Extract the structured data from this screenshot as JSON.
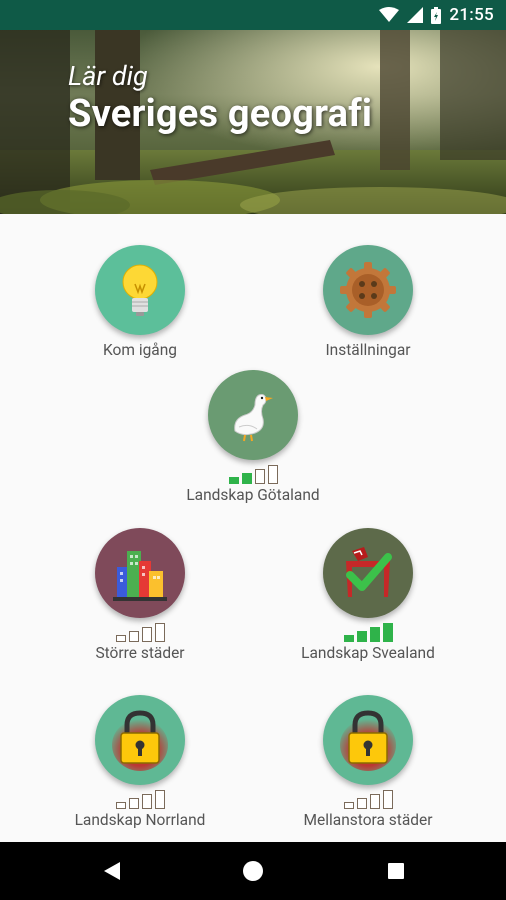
{
  "status_bar": {
    "time": "21:55"
  },
  "header": {
    "subtitle": "Lär dig",
    "title": "Sveriges geografi"
  },
  "tiles": [
    {
      "label": "Kom igång",
      "icon": "lightbulb-icon",
      "color": "#5cbf9a",
      "bars": null
    },
    {
      "label": "Inställningar",
      "icon": "cog-icon",
      "color": "#5fa88a",
      "bars": null
    },
    {
      "label": "Landskap Götaland",
      "icon": "goose-icon",
      "color": "#6a9b72",
      "bars": 2
    },
    {
      "label": "Större städer",
      "icon": "city-icon",
      "color": "#7f4a5a",
      "bars": 0
    },
    {
      "label": "Landskap Svealand",
      "icon": "checkmark-icon",
      "color": "#5d6a4a",
      "bars": 4
    },
    {
      "label": "Landskap Norrland",
      "icon": "lock-icon",
      "color": "#5fb894",
      "bars": 0
    },
    {
      "label": "Mellanstora städer",
      "icon": "lock-icon",
      "color": "#5fb894",
      "bars": 0
    }
  ],
  "colors": {
    "status_bar": "#0f5a47",
    "bar_active": "#2fb34a"
  }
}
